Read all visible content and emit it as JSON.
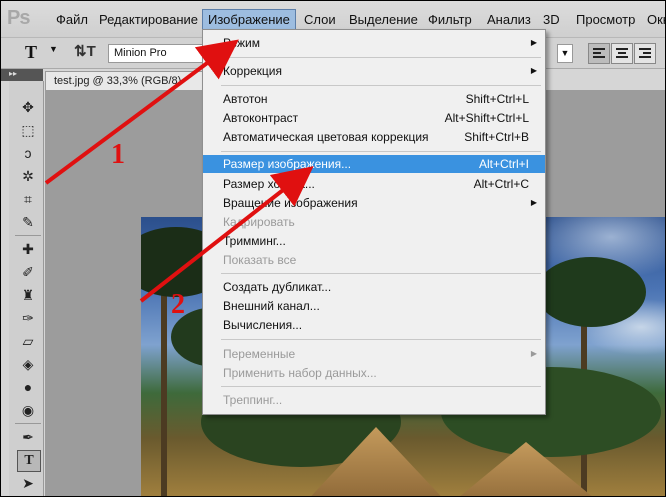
{
  "app": {
    "logo": "Ps"
  },
  "menubar": {
    "items": [
      "Файл",
      "Редактирование",
      "Изображение",
      "Слои",
      "Выделение",
      "Фильтр",
      "Анализ",
      "3D",
      "Просмотр",
      "Окно"
    ]
  },
  "options": {
    "font_family": "Minion Pro",
    "tool_glyph": "T",
    "orient_glyph": "⇅T"
  },
  "document": {
    "tab_title": "test.jpg @ 33,3% (RGB/8)"
  },
  "image_menu": {
    "items": [
      {
        "label": "Режим",
        "shortcut": "",
        "submenu": true,
        "disabled": false
      },
      {
        "label": "Коррекция",
        "shortcut": "",
        "submenu": true,
        "disabled": false
      },
      {
        "label": "Автотон",
        "shortcut": "Shift+Ctrl+L",
        "submenu": false,
        "disabled": false
      },
      {
        "label": "Автоконтраст",
        "shortcut": "Alt+Shift+Ctrl+L",
        "submenu": false,
        "disabled": false
      },
      {
        "label": "Автоматическая цветовая коррекция",
        "shortcut": "Shift+Ctrl+B",
        "submenu": false,
        "disabled": false
      },
      {
        "label": "Размер изображения...",
        "shortcut": "Alt+Ctrl+I",
        "submenu": false,
        "disabled": false,
        "highlighted": true
      },
      {
        "label": "Размер холста...",
        "shortcut": "Alt+Ctrl+C",
        "submenu": false,
        "disabled": false
      },
      {
        "label": "Вращение изображения",
        "shortcut": "",
        "submenu": true,
        "disabled": false
      },
      {
        "label": "Кадрировать",
        "shortcut": "",
        "submenu": false,
        "disabled": true
      },
      {
        "label": "Тримминг...",
        "shortcut": "",
        "submenu": false,
        "disabled": false
      },
      {
        "label": "Показать все",
        "shortcut": "",
        "submenu": false,
        "disabled": true
      },
      {
        "label": "Создать дубликат...",
        "shortcut": "",
        "submenu": false,
        "disabled": false
      },
      {
        "label": "Внешний канал...",
        "shortcut": "",
        "submenu": false,
        "disabled": false
      },
      {
        "label": "Вычисления...",
        "shortcut": "",
        "submenu": false,
        "disabled": false
      },
      {
        "label": "Переменные",
        "shortcut": "",
        "submenu": true,
        "disabled": true
      },
      {
        "label": "Применить набор данных...",
        "shortcut": "",
        "submenu": false,
        "disabled": true
      },
      {
        "label": "Треппинг...",
        "shortcut": "",
        "submenu": false,
        "disabled": true
      }
    ]
  },
  "annotations": {
    "label_1": "1",
    "label_2": "2",
    "color": "#e01010"
  },
  "colors": {
    "highlight": "#3a92e0",
    "menubar_active": "#9dbde0"
  }
}
